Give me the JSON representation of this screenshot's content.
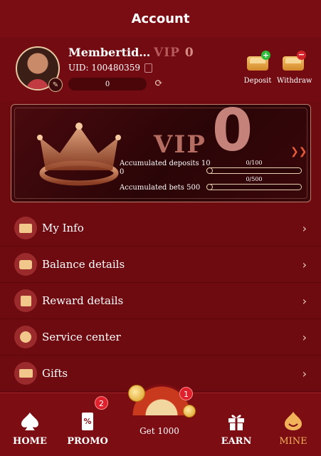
{
  "header": {
    "title": "Account"
  },
  "profile": {
    "username": "Membertid…",
    "vip_label": "VIP",
    "vip_level": "0",
    "uid_label": "UID: 100480359",
    "balance": "0"
  },
  "actions": [
    {
      "label": "Deposit"
    },
    {
      "label": "Withdraw"
    }
  ],
  "vip_card": {
    "vip_text": "VIP",
    "level": "0",
    "deposits_label_line1": "Accumulated deposits 10",
    "deposits_label_line2": "0",
    "deposits_progress": "0/100",
    "deposits_fraction": 0,
    "bets_label": "Accumulated bets 500",
    "bets_progress": "0/500",
    "bets_fraction": 0
  },
  "menu": [
    {
      "label": "My Info",
      "icon": "id-card-icon"
    },
    {
      "label": "Balance details",
      "icon": "wallet-icon"
    },
    {
      "label": "Reward details",
      "icon": "gift-icon"
    },
    {
      "label": "Service center",
      "icon": "headset-icon"
    },
    {
      "label": "Gifts",
      "icon": "ticket-icon"
    }
  ],
  "bottom_nav": {
    "home": "HOME",
    "promo": "PROMO",
    "promo_badge": "2",
    "get": "Get 1000",
    "get_badge": "1",
    "earn": "EARN",
    "mine": "MINE"
  },
  "colors": {
    "accent": "#f2b25a",
    "background": "#6e0b10",
    "badge": "#e0202c"
  }
}
